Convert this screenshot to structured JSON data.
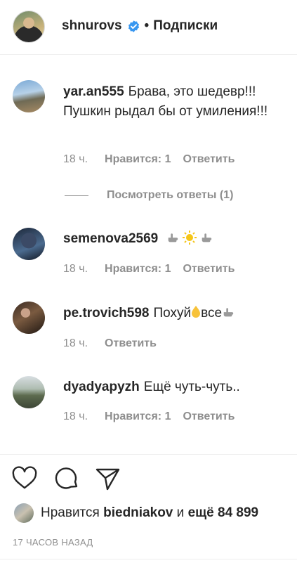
{
  "header": {
    "username": "shnurovs",
    "separator": "•",
    "follow_label": "Подписки"
  },
  "comments": [
    {
      "username": "yar.an555",
      "text": "Брава, это шедевр!!! Пушкин рыдал бы от умиления!!!",
      "time": "18 ч.",
      "likes_label": "Нравится: 1",
      "reply_label": "Ответить",
      "view_replies": "Посмотреть ответы (1)"
    },
    {
      "username": "semenova2569",
      "text": "",
      "emoji": [
        "pointing-hand-icon",
        "sun-icon",
        "pointing-hand-icon"
      ],
      "time": "18 ч.",
      "likes_label": "Нравится: 1",
      "reply_label": "Ответить"
    },
    {
      "username": "pe.trovich598",
      "text_before": "Похуй",
      "text_after": "все",
      "time": "18 ч.",
      "reply_label": "Ответить"
    },
    {
      "username": "dyadyapyzh",
      "text": "Ещё чуть-чуть..",
      "time": "18 ч.",
      "likes_label": "Нравится: 1",
      "reply_label": "Ответить"
    }
  ],
  "likes": {
    "prefix": "Нравится",
    "user": "biedniakov",
    "joiner": "и",
    "rest": "ещё 84 899"
  },
  "time_ago": "17 ЧАСОВ НАЗАД",
  "colors": {
    "verified": "#3897f0",
    "muted": "#8e8e8e",
    "text": "#262626"
  }
}
